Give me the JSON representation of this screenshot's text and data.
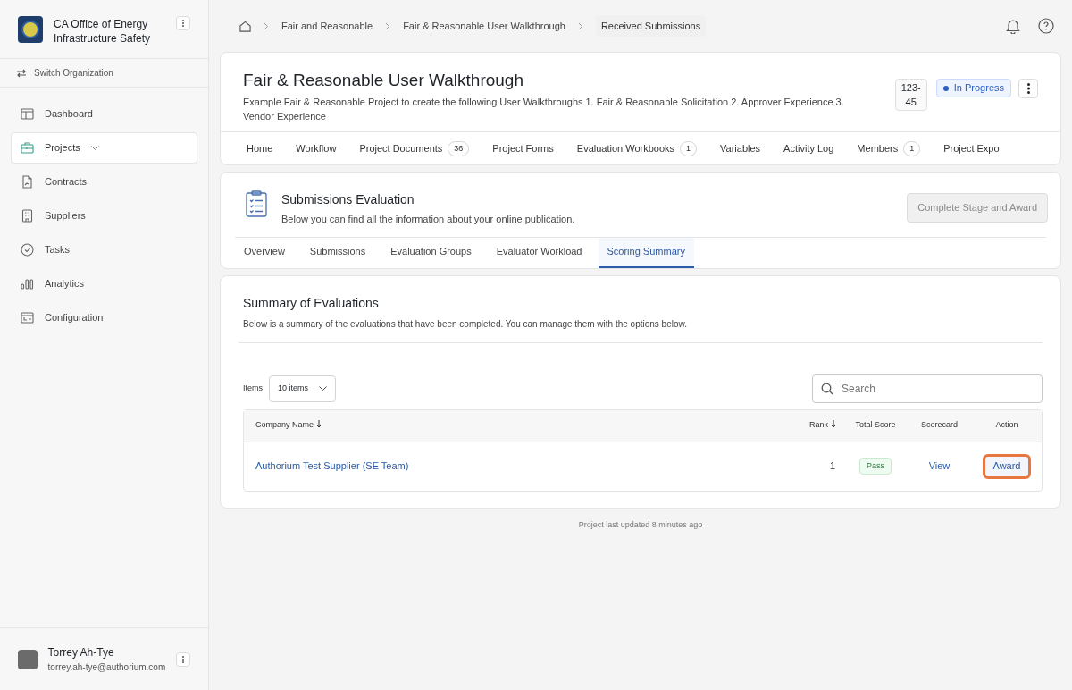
{
  "sidebar": {
    "org_name": "CA Office of Energy Infrastructure Safety",
    "switch_label": "Switch Organization",
    "items": [
      {
        "label": "Dashboard",
        "selected": false,
        "expandable": false
      },
      {
        "label": "Projects",
        "selected": true,
        "expandable": true
      },
      {
        "label": "Contracts",
        "selected": false,
        "expandable": false
      },
      {
        "label": "Suppliers",
        "selected": false,
        "expandable": false
      },
      {
        "label": "Tasks",
        "selected": false,
        "expandable": false
      },
      {
        "label": "Analytics",
        "selected": false,
        "expandable": false
      },
      {
        "label": "Configuration",
        "selected": false,
        "expandable": false
      }
    ],
    "user": {
      "name": "Torrey Ah-Tye",
      "email": "torrey.ah-tye@authorium.com"
    }
  },
  "breadcrumbs": [
    {
      "label": "Fair and Reasonable",
      "current": false
    },
    {
      "label": "Fair & Reasonable User Walkthrough",
      "current": false
    },
    {
      "label": "Received Submissions",
      "current": true
    }
  ],
  "project": {
    "title": "Fair & Reasonable User Walkthrough",
    "description": "Example Fair & Reasonable Project to create the following User Walkthroughs 1. Fair & Reasonable Solicitation 2. Approver Experience 3. Vendor Experience",
    "number": "123-\n45",
    "status": "In Progress",
    "tabs": [
      {
        "label": "Home"
      },
      {
        "label": "Workflow"
      },
      {
        "label": "Project Documents",
        "count": "36"
      },
      {
        "label": "Project Forms"
      },
      {
        "label": "Evaluation Workbooks",
        "count": "1"
      },
      {
        "label": "Variables"
      },
      {
        "label": "Activity Log"
      },
      {
        "label": "Members",
        "count": "1"
      },
      {
        "label": "Project Expo"
      }
    ]
  },
  "stage": {
    "title": "Submissions Evaluation",
    "subtitle": "Below you can find all the information about your online publication.",
    "action": {
      "label": "Complete Stage and Award",
      "disabled": true
    },
    "tabs": [
      {
        "label": "Overview",
        "selected": false
      },
      {
        "label": "Submissions",
        "selected": false
      },
      {
        "label": "Evaluation Groups",
        "selected": false
      },
      {
        "label": "Evaluator Workload",
        "selected": false
      },
      {
        "label": "Scoring Summary",
        "selected": true
      }
    ]
  },
  "summary": {
    "title": "Summary of Evaluations",
    "description": "Below is a summary of the evaluations that have been completed. You can manage them with the options below.",
    "items_label": "Items",
    "items_value": "10 items",
    "search_placeholder": "Search",
    "columns": [
      {
        "label": "Company Name",
        "sortable": true
      },
      {
        "label": "Rank",
        "sortable": true
      },
      {
        "label": "Total Score",
        "sortable": false
      },
      {
        "label": "Scorecard",
        "sortable": false
      },
      {
        "label": "Action",
        "sortable": false
      }
    ],
    "rows": [
      {
        "company": "Authorium Test Supplier (SE Team)",
        "rank": "1",
        "score": "Pass",
        "scorecard": "View",
        "action": "Award",
        "highlighted": true
      }
    ]
  },
  "footer": "Project last updated 8 minutes ago"
}
